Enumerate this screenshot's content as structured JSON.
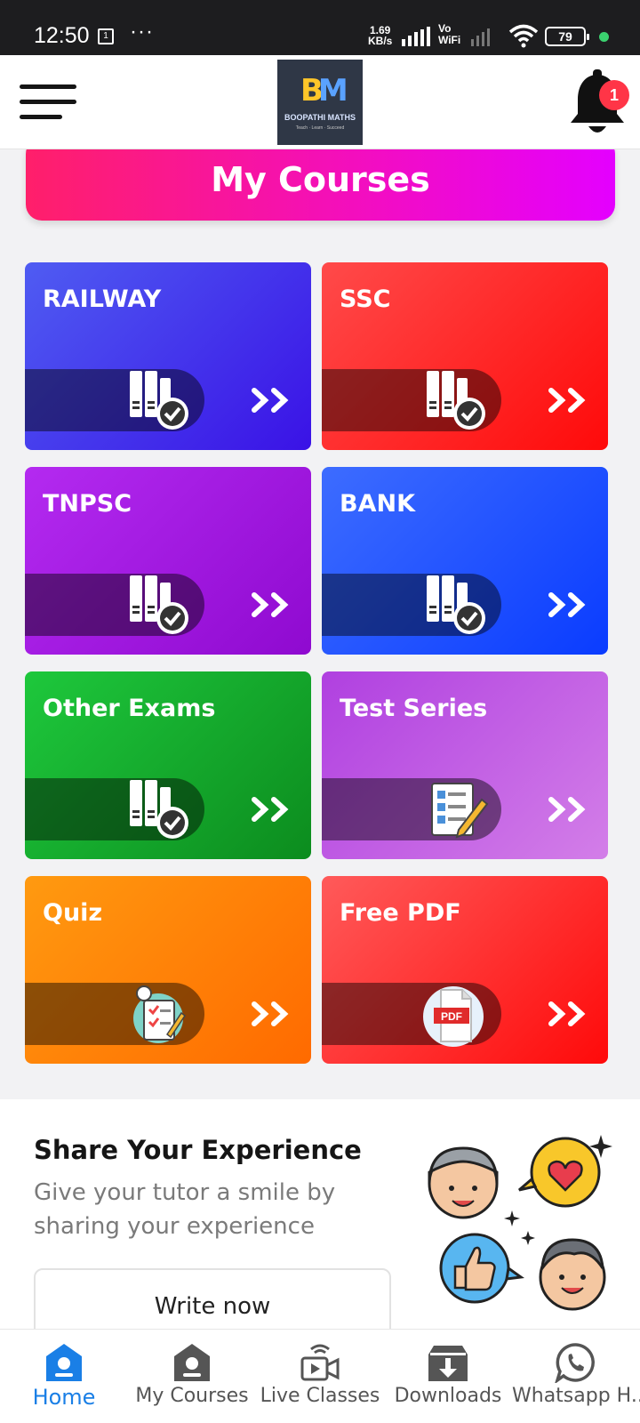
{
  "status_bar": {
    "time": "12:50",
    "notification_box": "1",
    "overflow": "···",
    "speed_value": "1.69",
    "speed_unit": "KB/s",
    "vowifi_line1": "Vo",
    "vowifi_line2": "WiFi",
    "battery": "79"
  },
  "header": {
    "logo_mark_b": "B",
    "logo_mark_m": "M",
    "logo_text": "BOOPATHI MATHS",
    "logo_tagline": "Teach · Learn · Succeed",
    "notification_count": "1"
  },
  "my_courses": {
    "title": "My Courses"
  },
  "courses": [
    {
      "label": "RAILWAY",
      "icon": "books-check-icon",
      "color_start": "#4f5cf2",
      "color_end": "#3a12e6"
    },
    {
      "label": "SSC",
      "icon": "books-check-icon",
      "color_start": "#ff4a4a",
      "color_end": "#ff0a0a"
    },
    {
      "label": "TNPSC",
      "icon": "books-check-icon",
      "color_start": "#b42af0",
      "color_end": "#8f0ad0"
    },
    {
      "label": "BANK",
      "icon": "books-check-icon",
      "color_start": "#3d6cff",
      "color_end": "#0a3cff"
    },
    {
      "label": "Other Exams",
      "icon": "books-check-icon",
      "color_start": "#1ec83c",
      "color_end": "#0c8c1e"
    },
    {
      "label": "Test Series",
      "icon": "test-checklist-icon",
      "color_start": "#b040e0",
      "color_end": "#d37ee8"
    },
    {
      "label": "Quiz",
      "icon": "quiz-clipboard-icon",
      "color_start": "#ff9a10",
      "color_end": "#ff6a00"
    },
    {
      "label": "Free PDF",
      "icon": "pdf-file-icon",
      "color_start": "#ff5a5a",
      "color_end": "#ff0a0a"
    }
  ],
  "share": {
    "title": "Share Your Experience",
    "text": "Give your tutor a smile by sharing your experience",
    "button": "Write now"
  },
  "bottom_nav": [
    {
      "label": "Home",
      "icon": "home-icon",
      "active": true
    },
    {
      "label": "My Courses",
      "icon": "courses-icon",
      "active": false
    },
    {
      "label": "Live Classes",
      "icon": "live-video-icon",
      "active": false
    },
    {
      "label": "Downloads",
      "icon": "download-icon",
      "active": false
    },
    {
      "label": "Whatsapp H...",
      "icon": "whatsapp-icon",
      "active": false
    }
  ],
  "colors": {
    "accent": "#1a7fe6",
    "header_gradient_start": "#ff1f6a",
    "header_gradient_end": "#e400ff",
    "badge": "#ff3547"
  }
}
